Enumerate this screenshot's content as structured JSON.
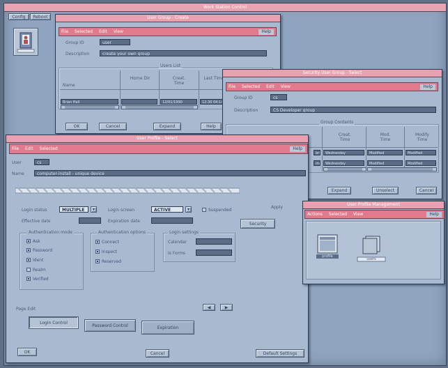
{
  "desktop_title": "Work Station Control",
  "desktop_buttons": [
    "Config",
    "Reboot"
  ],
  "win_group_create": {
    "title": "User Group - Create",
    "menus": [
      "File",
      "Selected",
      "Edit",
      "View"
    ],
    "help": "Help",
    "fields": [
      {
        "label": "Group ID",
        "value": "user"
      },
      {
        "label": "Description",
        "value": "create your own group"
      }
    ],
    "list_title": "Users List",
    "columns": [
      "Name",
      "Home Dir",
      "Creat. Time",
      "Last Time"
    ],
    "rows": [
      [
        "Brian Hall",
        "",
        "12/01/1990",
        "12:30 04:14"
      ]
    ],
    "buttons": [
      "OK",
      "Cancel",
      "Expand",
      "Help"
    ]
  },
  "win_group_select": {
    "title": "Security User Group - Select",
    "menus": [
      "File",
      "Selected",
      "Edit",
      "View"
    ],
    "help": "Help",
    "fields": [
      {
        "label": "Group ID",
        "value": "cs"
      },
      {
        "label": "Description",
        "value": "CS Developer group"
      }
    ],
    "list_title": "Group Contents",
    "columns": [
      "",
      "Creat. Time",
      "Mod. Time",
      "Modify Time"
    ],
    "rows": [
      [
        "brian",
        "Wednesday",
        "Modified",
        "Modified"
      ],
      [
        "mark",
        "Wednesday",
        "Modified",
        "Modified"
      ]
    ],
    "buttons": [
      "Expand",
      "Unselect",
      "Cancel"
    ]
  },
  "win_user_profile": {
    "title": "User Profile - Select",
    "menus": [
      "File",
      "Edit",
      "Selected"
    ],
    "help": "Help",
    "user_label": "User",
    "user_value": "cs",
    "name_label": "Name",
    "name_value": "computer-install - unique device",
    "login_status_label": "Login status",
    "login_status_value": "MULTIPLE",
    "login_screen_label": "Login screen",
    "login_screen_value": "ACTIVE",
    "suspended_label": "Suspended",
    "effective_date_label": "Effective date",
    "expiration_date_label": "Expiration date",
    "right_label": "Apply",
    "security_button": "Security",
    "box1_title": "Authentication mode",
    "box1_items": [
      {
        "label": "Ask",
        "checked": true
      },
      {
        "label": "Password",
        "checked": true
      },
      {
        "label": "Ident",
        "checked": true
      },
      {
        "label": "Realm",
        "checked": false
      },
      {
        "label": "Verified",
        "checked": true
      }
    ],
    "box2_title": "Authentication options",
    "box2_items": [
      {
        "label": "Connect",
        "checked": true
      },
      {
        "label": "Inspect",
        "checked": true
      },
      {
        "label": "Reserved",
        "checked": true
      }
    ],
    "box3_title": "Login settings",
    "box3_fields": [
      "Calendar",
      "Is Forms"
    ],
    "page_label": "Page Edit",
    "tabs": [
      "Login Control",
      "Password Control",
      "Expiration"
    ],
    "bottom_buttons": [
      "OK",
      "Cancel",
      "Default Settings"
    ]
  },
  "win_profile_mgmt": {
    "title": "User Profile Management",
    "menus": [
      "Actions",
      "Selected",
      "View"
    ],
    "help": "Help",
    "items": [
      "profile",
      "users"
    ]
  }
}
